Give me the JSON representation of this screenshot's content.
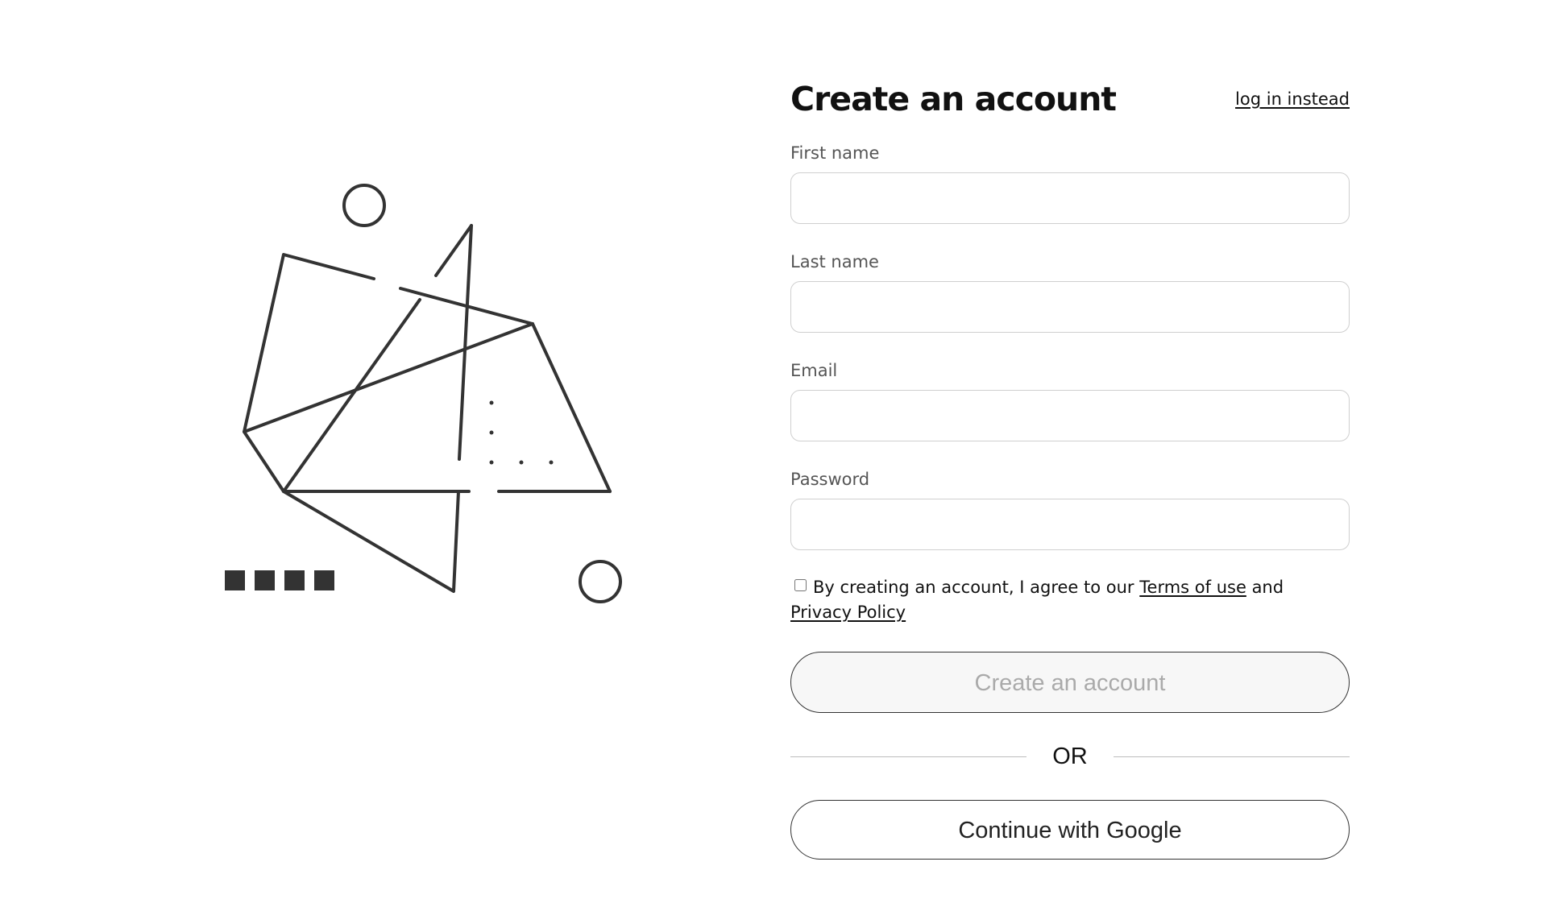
{
  "illustration": {
    "stroke_color": "#333333",
    "name": "abstract-geometric-illustration"
  },
  "form": {
    "title": "Create an account",
    "login_link": "log in instead",
    "fields": [
      {
        "label": "First name",
        "value": ""
      },
      {
        "label": "Last name",
        "value": ""
      },
      {
        "label": "Email",
        "value": ""
      },
      {
        "label": "Password",
        "value": ""
      }
    ],
    "terms": {
      "prefix": "By creating an account, I agree to our",
      "terms_link": "Terms of use",
      "connector": "and",
      "privacy_link": "Privacy Policy",
      "checked": false
    },
    "create_button": "Create an account",
    "divider": "OR",
    "google_button": "Continue with Google"
  },
  "colors": {
    "text": "#111111",
    "label": "#555555",
    "border": "#cfcfcf",
    "button_disabled_bg": "#f7f7f7",
    "button_disabled_text": "#aaaaaa"
  }
}
